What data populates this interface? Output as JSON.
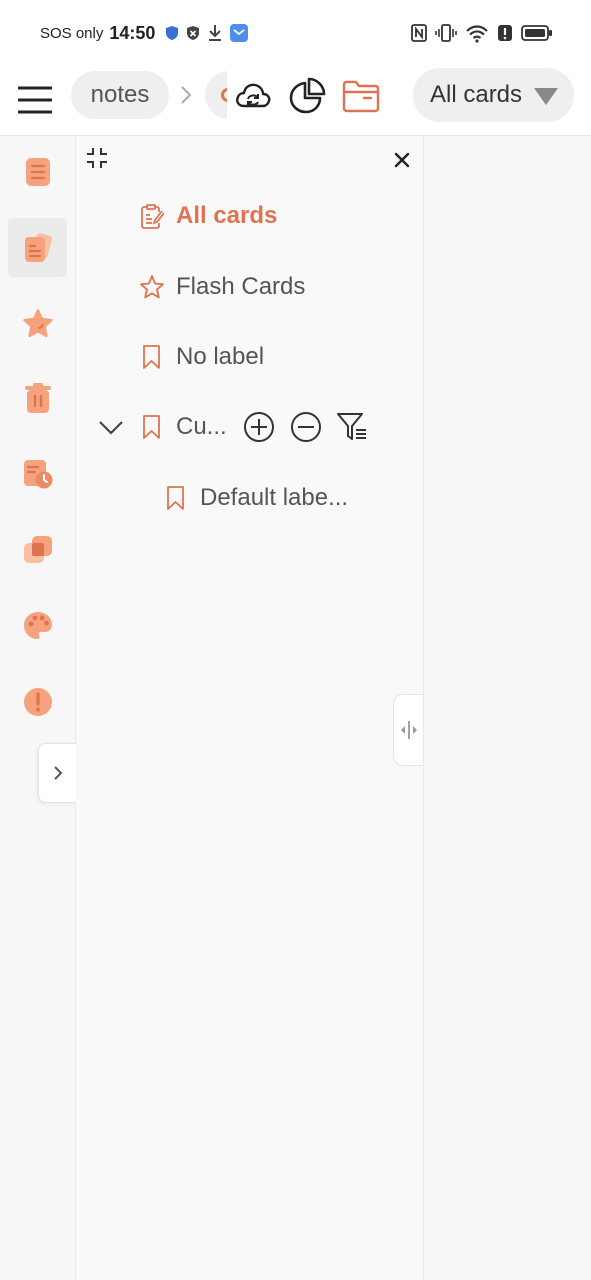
{
  "status_bar": {
    "carrier": "SOS only",
    "time": "14:50"
  },
  "header": {
    "breadcrumb": [
      "notes"
    ],
    "filter_label": "All cards"
  },
  "drawer": {
    "items": [
      {
        "label": "All cards",
        "icon": "clipboard-icon",
        "active": true
      },
      {
        "label": "Flash Cards",
        "icon": "star-outline-icon"
      },
      {
        "label": "No label",
        "icon": "bookmark-icon"
      },
      {
        "label": "Cu...",
        "icon": "bookmark-icon",
        "expanded": true
      },
      {
        "label": "Default labe...",
        "icon": "bookmark-icon",
        "child": true
      }
    ]
  },
  "rail": {
    "items": [
      "list-icon",
      "cards-icon",
      "star-icon",
      "trash-icon",
      "history-icon",
      "layers-icon",
      "palette-icon",
      "alert-icon"
    ],
    "active_index": 1
  },
  "colors": {
    "accent": "#e0734f",
    "accent_light": "#f6a27c",
    "chip_bg": "#efefef",
    "panel_bg": "#f9f9f9"
  }
}
